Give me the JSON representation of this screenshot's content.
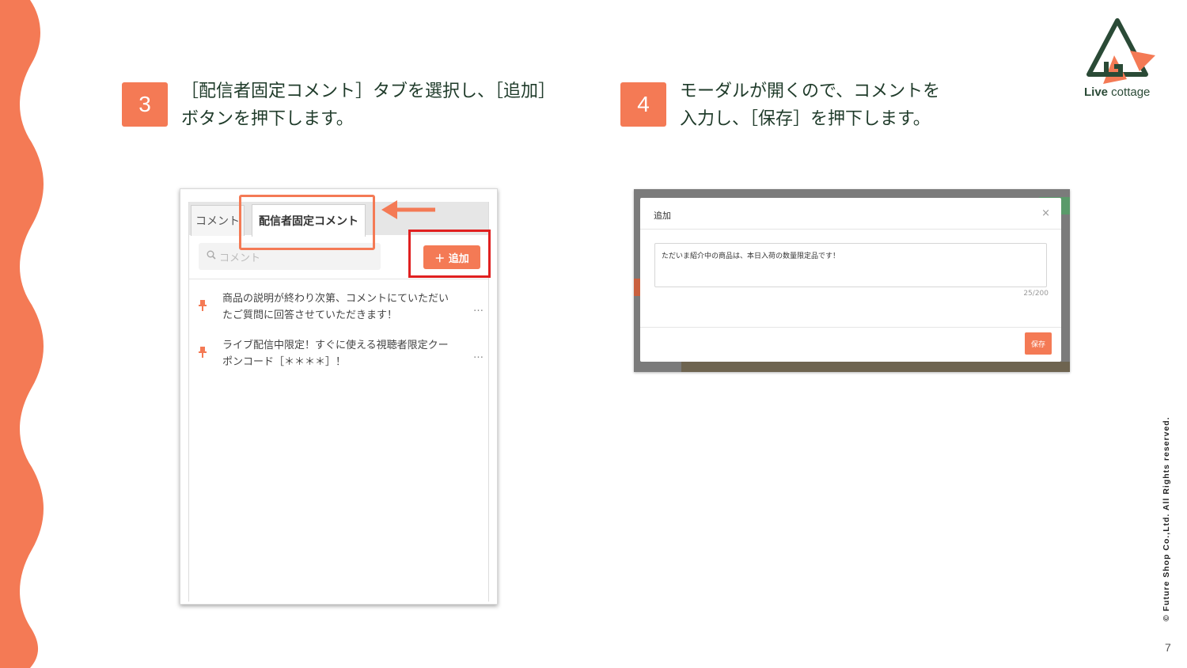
{
  "steps": [
    {
      "number": "3",
      "text": "［配信者固定コメント］タブを選択し、［追加］\nボタンを押下します。"
    },
    {
      "number": "4",
      "text": "モーダルが開くので、コメントを\n入力し、［保存］を押下します。"
    }
  ],
  "logo": {
    "bold": "Live",
    "rest": " cottage"
  },
  "copyright": "© Future Shop Co.,Ltd. All Rights reserved.",
  "page_number": "7",
  "screenshot1": {
    "tab_comment": "コメント",
    "tab_pinned": "配信者固定コメント",
    "search_placeholder": "コメント",
    "search_icon": "search-icon",
    "add_button": "＋ 追加",
    "comments": [
      {
        "text": "商品の説明が終わり次第、コメントにていただいたご質問に回答させていただきます！",
        "more": "…"
      },
      {
        "text": "ライブ配信中限定！すぐに使える視聴者限定クーポンコード［＊＊＊＊］！",
        "more": "…"
      }
    ]
  },
  "screenshot2": {
    "modal_title": "追加",
    "close": "×",
    "textarea_value": "ただいま紹介中の商品は、本日入荷の数量限定品です！",
    "char_count": "25/200",
    "save_button": "保存"
  },
  "colors": {
    "accent": "#f47a55",
    "highlight_red": "#e02020",
    "text": "#1f3b2a"
  }
}
